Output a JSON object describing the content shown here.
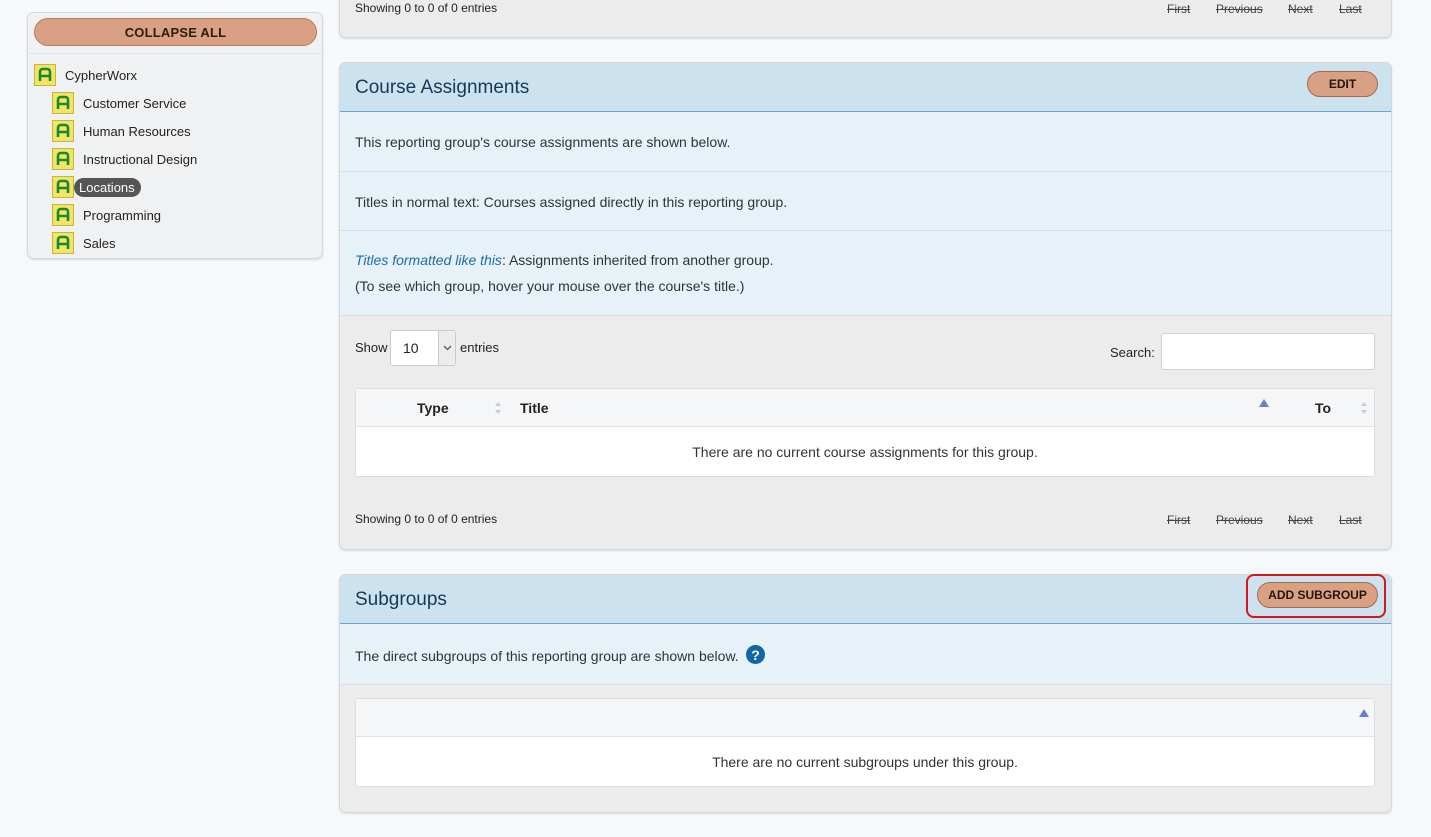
{
  "sidebar": {
    "collapse_label": "COLLAPSE ALL",
    "root": {
      "label": "CypherWorx",
      "icon": "group-icon"
    },
    "items": [
      {
        "label": "Customer Service",
        "icon": "group-icon",
        "selected": false
      },
      {
        "label": "Human Resources",
        "icon": "group-icon",
        "selected": false
      },
      {
        "label": "Instructional Design",
        "icon": "group-icon",
        "selected": false
      },
      {
        "label": "Locations",
        "icon": "group-icon",
        "selected": true
      },
      {
        "label": "Programming",
        "icon": "group-icon",
        "selected": false
      },
      {
        "label": "Sales",
        "icon": "group-icon",
        "selected": false
      }
    ]
  },
  "top_panel": {
    "showing": "Showing 0 to 0 of 0 entries",
    "pager": {
      "first": "First",
      "previous": "Previous",
      "next": "Next",
      "last": "Last"
    }
  },
  "course_assignments": {
    "title": "Course Assignments",
    "edit_label": "EDIT",
    "info_1": "This reporting group's course assignments are shown below.",
    "info_2": "Titles in normal text: Courses assigned directly in this reporting group.",
    "info_3_italic": "Titles formatted like this",
    "info_3_rest": ": Assignments inherited from another group.",
    "info_4": "(To see which group, hover your mouse over the course's title.)",
    "show_label": "Show",
    "entries_value": "10",
    "entries_label": "entries",
    "search_label": "Search:",
    "search_value": "",
    "columns": {
      "type": "Type",
      "title": "Title",
      "to": "To"
    },
    "empty_message": "There are no current course assignments for this group.",
    "showing": "Showing 0 to 0 of 0 entries",
    "pager": {
      "first": "First",
      "previous": "Previous",
      "next": "Next",
      "last": "Last"
    }
  },
  "subgroups": {
    "title": "Subgroups",
    "add_label": "ADD SUBGROUP",
    "info": "The direct subgroups of this reporting group are shown below.",
    "help_glyph": "?",
    "empty_message": "There are no current subgroups under this group."
  },
  "colors": {
    "button_fill": "#d9a083",
    "header_fill": "#cce2ee",
    "info_fill": "#e6f1f8",
    "highlight_outline": "#d6161f",
    "help_icon": "#1166a6"
  }
}
